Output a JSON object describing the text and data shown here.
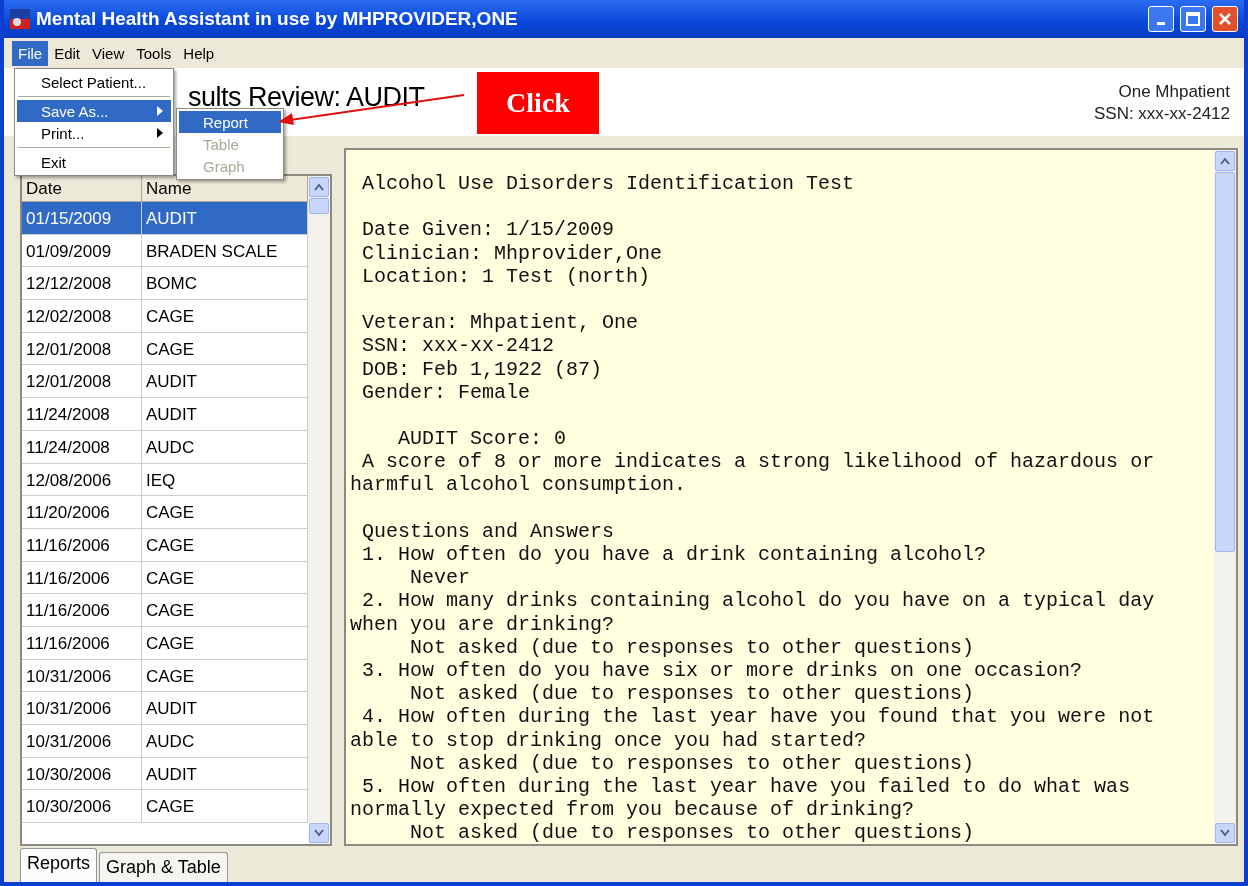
{
  "window": {
    "title": "Mental Health Assistant in use by MHPROVIDER,ONE"
  },
  "menu_bar": [
    {
      "label": "File",
      "selected": true
    },
    {
      "label": "Edit",
      "selected": false
    },
    {
      "label": "View",
      "selected": false
    },
    {
      "label": "Tools",
      "selected": false
    },
    {
      "label": "Help",
      "selected": false
    }
  ],
  "file_menu": [
    {
      "kind": "item",
      "label": "Select Patient...",
      "selected": false,
      "submenu": false
    },
    {
      "kind": "separator"
    },
    {
      "kind": "item",
      "label": "Save As...",
      "selected": true,
      "submenu": true
    },
    {
      "kind": "item",
      "label": "Print...",
      "selected": false,
      "submenu": true
    },
    {
      "kind": "separator"
    },
    {
      "kind": "item",
      "label": "Exit",
      "selected": false,
      "submenu": false
    }
  ],
  "save_as_submenu": [
    {
      "label": "Report",
      "selected": true,
      "disabled": false
    },
    {
      "label": "Table",
      "selected": false,
      "disabled": true
    },
    {
      "label": "Graph",
      "selected": false,
      "disabled": true
    }
  ],
  "heading": "sults Review: AUDIT",
  "callout": "Click",
  "patient": {
    "name": "One Mhpatient",
    "ssn": "SSN: xxx-xx-2412"
  },
  "table": {
    "columns": [
      "Date",
      "Name"
    ],
    "rows": [
      {
        "date": "01/15/2009",
        "name": "AUDIT",
        "selected": true
      },
      {
        "date": "01/09/2009",
        "name": "BRADEN SCALE",
        "selected": false
      },
      {
        "date": "12/12/2008",
        "name": "BOMC",
        "selected": false
      },
      {
        "date": "12/02/2008",
        "name": "CAGE",
        "selected": false
      },
      {
        "date": "12/01/2008",
        "name": "CAGE",
        "selected": false
      },
      {
        "date": "12/01/2008",
        "name": "AUDIT",
        "selected": false
      },
      {
        "date": "11/24/2008",
        "name": "AUDIT",
        "selected": false
      },
      {
        "date": "11/24/2008",
        "name": "AUDC",
        "selected": false
      },
      {
        "date": "12/08/2006",
        "name": "IEQ",
        "selected": false
      },
      {
        "date": "11/20/2006",
        "name": "CAGE",
        "selected": false
      },
      {
        "date": "11/16/2006",
        "name": "CAGE",
        "selected": false
      },
      {
        "date": "11/16/2006",
        "name": "CAGE",
        "selected": false
      },
      {
        "date": "11/16/2006",
        "name": "CAGE",
        "selected": false
      },
      {
        "date": "11/16/2006",
        "name": "CAGE",
        "selected": false
      },
      {
        "date": "10/31/2006",
        "name": "CAGE",
        "selected": false
      },
      {
        "date": "10/31/2006",
        "name": "AUDIT",
        "selected": false
      },
      {
        "date": "10/31/2006",
        "name": "AUDC",
        "selected": false
      },
      {
        "date": "10/30/2006",
        "name": "AUDIT",
        "selected": false
      },
      {
        "date": "10/30/2006",
        "name": "CAGE",
        "selected": false
      }
    ]
  },
  "report_blocks": [
    {
      "lines": [
        " Alcohol Use Disorders Identification Test"
      ]
    },
    {
      "lines": [
        " Date Given: 1/15/2009",
        " Clinician: Mhprovider,One",
        " Location: 1 Test (north)"
      ]
    },
    {
      "lines": [
        " Veteran: Mhpatient, One",
        " SSN: xxx-xx-2412",
        " DOB: Feb 1,1922 (87)",
        " Gender: Female"
      ]
    },
    {
      "lines": [
        "    AUDIT Score: 0",
        " A score of 8 or more indicates a strong likelihood of hazardous or",
        "harmful alcohol consumption."
      ]
    },
    {
      "lines": [
        " Questions and Answers",
        " 1. How often do you have a drink containing alcohol?",
        "     Never",
        " 2. How many drinks containing alcohol do you have on a typical day",
        "when you are drinking?",
        "     Not asked (due to responses to other questions)",
        " 3. How often do you have six or more drinks on one occasion?",
        "     Not asked (due to responses to other questions)",
        " 4. How often during the last year have you found that you were not",
        "able to stop drinking once you had started?",
        "     Not asked (due to responses to other questions)",
        " 5. How often during the last year have you failed to do what was",
        "normally expected from you because of drinking?",
        "     Not asked (due to responses to other questions)"
      ]
    }
  ],
  "tabs": [
    {
      "label": "Reports",
      "selected": true
    },
    {
      "label": "Graph & Table",
      "selected": false
    }
  ]
}
